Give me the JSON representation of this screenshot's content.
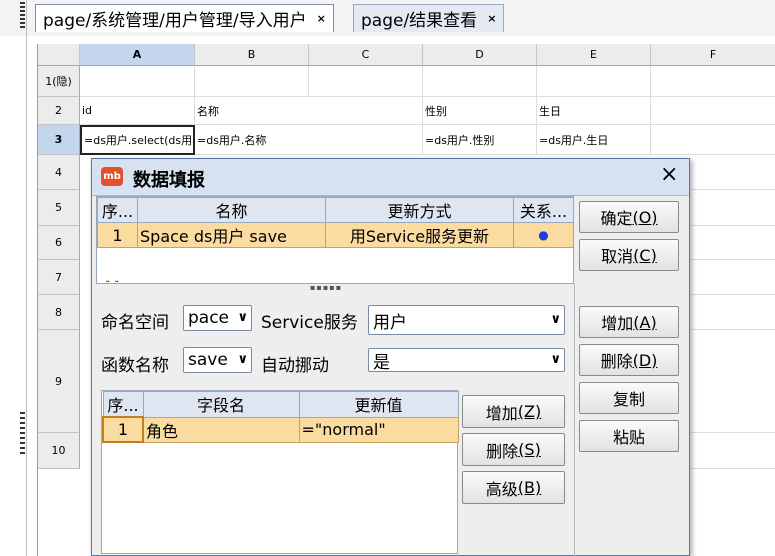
{
  "tabs": [
    {
      "label": "page/系统管理/用户管理/导入用户",
      "close": "×",
      "active": true
    },
    {
      "label": "page/结果查看",
      "close": "×",
      "active": false
    }
  ],
  "sheet": {
    "columns": [
      "A",
      "B",
      "C",
      "D",
      "E",
      "F"
    ],
    "rows": [
      "1(隐)",
      "2",
      "3",
      "4",
      "5",
      "6",
      "7",
      "8",
      "9",
      "10"
    ],
    "cells": {
      "row2": {
        "A": "id",
        "B": "名称",
        "D": "性别",
        "E": "生日"
      },
      "row3": {
        "A": "=ds用户.select(ds用",
        "B": "=ds用户.名称",
        "D": "=ds用户.性别",
        "E": "=ds用户.生日"
      }
    }
  },
  "dialog": {
    "title": "数据填报",
    "logo": "mb",
    "close": "×",
    "top_table": {
      "headers": [
        "序...",
        "名称",
        "更新方式",
        "关系..."
      ],
      "rows": [
        {
          "seq": "1",
          "name": "Space  ds用户  save",
          "mode": "用Service服务更新",
          "rel": "●"
        }
      ]
    },
    "fragment_left": "˘ ˘",
    "fragment_mid": "▪▪▪▪▪",
    "right_buttons": {
      "ok": {
        "text": "确定",
        "key": "(O)"
      },
      "cancel": {
        "text": "取消",
        "key": "(C)"
      },
      "add": {
        "text": "增加",
        "key": "(A)"
      },
      "delete": {
        "text": "删除",
        "key": "(D)"
      },
      "copy": {
        "text": "复制"
      },
      "paste": {
        "text": "粘贴"
      }
    },
    "form": {
      "namespace_label": "命名空间",
      "namespace_value": "pace",
      "service_label": "Service服务",
      "service_value": "用户",
      "function_label": "函数名称",
      "function_value": "save",
      "auto_label": "自动挪动",
      "auto_value": "是"
    },
    "field_table": {
      "headers": [
        "序...",
        "字段名",
        "更新值"
      ],
      "rows": [
        {
          "seq": "1",
          "field": "角色",
          "value": "=\"normal\""
        }
      ]
    },
    "field_buttons": {
      "add": {
        "text": "增加",
        "key": "(Z)"
      },
      "delete": {
        "text": "删除",
        "key": "(S)"
      },
      "advanced": {
        "text": "高级",
        "key": "(B)"
      }
    }
  },
  "colors": {
    "accent": "#d6e2f1",
    "selected_row": "#fbdca0",
    "logo": "#e4502a",
    "relation_dot": "#1a3fd8"
  }
}
